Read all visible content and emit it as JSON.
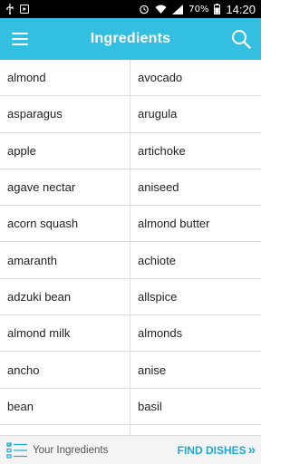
{
  "status_bar": {
    "battery_percent": "70%",
    "time": "14:20"
  },
  "app_bar": {
    "title": "Ingredients"
  },
  "ingredients": [
    [
      "almond",
      "avocado"
    ],
    [
      "asparagus",
      "arugula"
    ],
    [
      "apple",
      "artichoke"
    ],
    [
      "agave nectar",
      "aniseed"
    ],
    [
      "acorn squash",
      "almond butter"
    ],
    [
      "amaranth",
      "achiote"
    ],
    [
      "adzuki bean",
      "allspice"
    ],
    [
      "almond milk",
      "almonds"
    ],
    [
      "ancho",
      "anise"
    ],
    [
      "bean",
      "basil"
    ],
    [
      "",
      ""
    ]
  ],
  "bottom_bar": {
    "your_ingredients_label": "Your Ingredients",
    "find_dishes_label": "FIND DISHES",
    "find_dishes_icon": "»"
  },
  "colors": {
    "primary": "#33bfe0",
    "accent_text": "#1fa9cf"
  }
}
